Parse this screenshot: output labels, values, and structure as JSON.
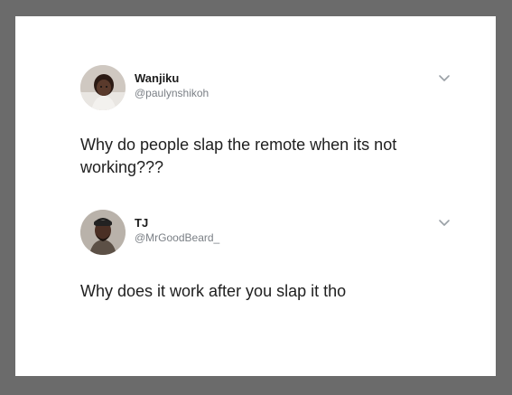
{
  "colors": {
    "frame_background": "#6b6b6b",
    "card_background": "#ffffff",
    "name_color": "#1c1c1c",
    "handle_color": "#7a7f85",
    "text_color": "#202020"
  },
  "tweets": [
    {
      "display_name": "Wanjiku",
      "handle": "@paulynshikoh",
      "text": "Why do people slap the remote when its not working???",
      "avatar_icon": "avatar-photo-icon",
      "menu_icon": "chevron-down-icon"
    },
    {
      "display_name": "TJ",
      "handle": "@MrGoodBeard_",
      "text": "Why does it work after you slap it tho",
      "avatar_icon": "avatar-photo-icon",
      "menu_icon": "chevron-down-icon"
    }
  ]
}
